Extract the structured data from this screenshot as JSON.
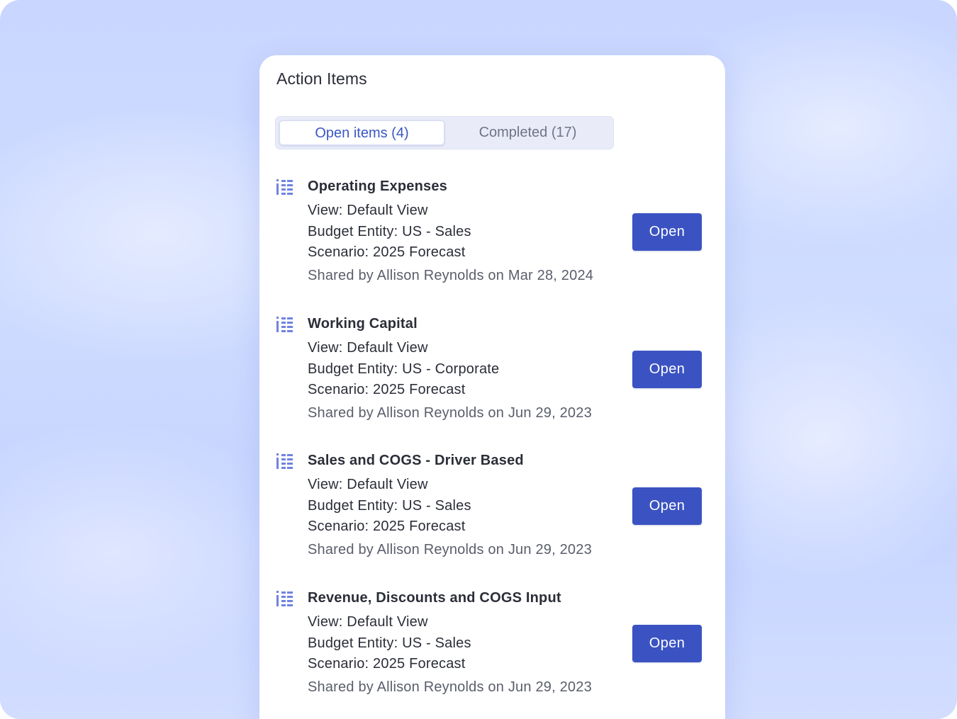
{
  "card": {
    "title": "Action Items"
  },
  "tabs": {
    "open_label": "Open items (4)",
    "completed_label": "Completed (17)"
  },
  "colors": {
    "accent": "#3b53c2",
    "icon": "#7082e0"
  },
  "items": [
    {
      "icon": "list-icon",
      "title": "Operating Expenses",
      "view": "View: Default View",
      "entity": "Budget Entity: US - Sales",
      "scenario": "Scenario: 2025 Forecast",
      "shared": "Shared by Allison Reynolds on Mar 28, 2024",
      "button": "Open"
    },
    {
      "icon": "list-icon",
      "title": "Working Capital",
      "view": "View: Default View",
      "entity": "Budget Entity: US - Corporate",
      "scenario": "Scenario: 2025 Forecast",
      "shared": "Shared by Allison Reynolds on Jun 29, 2023",
      "button": "Open"
    },
    {
      "icon": "list-icon",
      "title": "Sales and COGS - Driver Based",
      "view": "View: Default View",
      "entity": "Budget Entity: US - Sales",
      "scenario": "Scenario: 2025 Forecast",
      "shared": "Shared by Allison Reynolds on Jun 29, 2023",
      "button": "Open"
    },
    {
      "icon": "list-icon",
      "title": "Revenue, Discounts and COGS Input",
      "view": "View: Default View",
      "entity": "Budget Entity: US - Sales",
      "scenario": "Scenario: 2025 Forecast",
      "shared": "Shared by Allison Reynolds on Jun 29, 2023",
      "button": "Open"
    }
  ]
}
